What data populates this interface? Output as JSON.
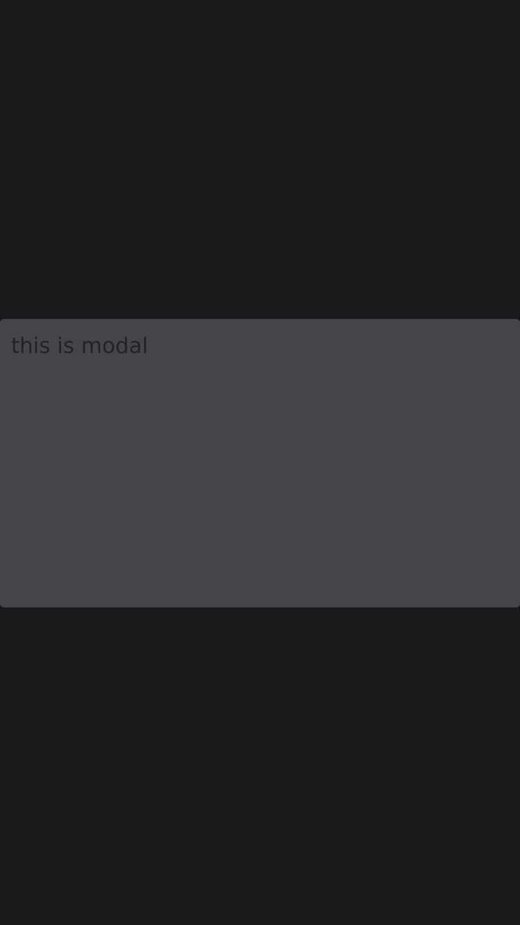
{
  "modal": {
    "text": "this is modal"
  },
  "colors": {
    "background": "#1a1a1c",
    "modal_background": "#46454b",
    "modal_text": "#222126"
  }
}
